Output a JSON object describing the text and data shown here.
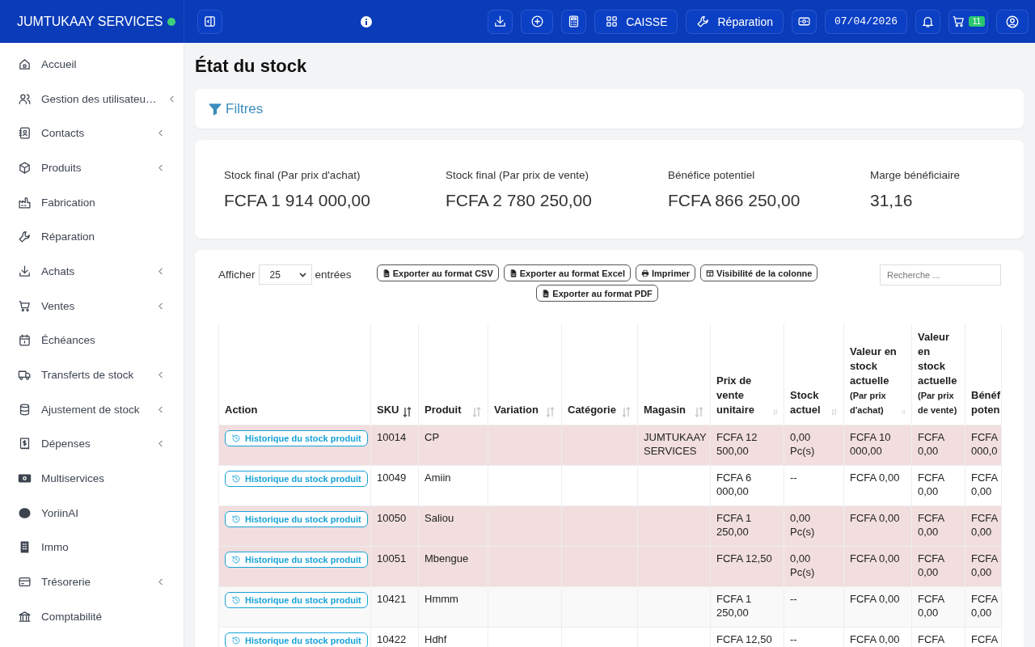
{
  "brand": {
    "name": "JUMTUKAAY SERVICES",
    "online": true
  },
  "topbar": {
    "caisse": "CAISSE",
    "repair": "Réparation",
    "date": "07/04/2026",
    "cart_count": "11"
  },
  "sidebar": {
    "items": [
      {
        "label": "Accueil",
        "submenu": false
      },
      {
        "label": "Gestion des utilisateu…",
        "submenu": true
      },
      {
        "label": "Contacts",
        "submenu": true
      },
      {
        "label": "Produits",
        "submenu": true
      },
      {
        "label": "Fabrication",
        "submenu": false
      },
      {
        "label": "Réparation",
        "submenu": false
      },
      {
        "label": "Achats",
        "submenu": true
      },
      {
        "label": "Ventes",
        "submenu": true
      },
      {
        "label": "Échéances",
        "submenu": false
      },
      {
        "label": "Transferts de stock",
        "submenu": true
      },
      {
        "label": "Ajustement de stock",
        "submenu": true
      },
      {
        "label": "Dépenses",
        "submenu": true
      },
      {
        "label": "Multiservices",
        "submenu": false
      },
      {
        "label": "YoriinAI",
        "submenu": false
      },
      {
        "label": "Immo",
        "submenu": false
      },
      {
        "label": "Trésorerie",
        "submenu": true
      },
      {
        "label": "Comptabilité",
        "submenu": false
      }
    ]
  },
  "page_title": "État du stock",
  "filters": {
    "label": "Filtres"
  },
  "summary": [
    {
      "label": "Stock final (Par prix d'achat)",
      "value": "FCFA 1 914 000,00"
    },
    {
      "label": "Stock final (Par prix de vente)",
      "value": "FCFA 2 780 250,00"
    },
    {
      "label": "Bénéfice potentiel",
      "value": "FCFA 866 250,00"
    },
    {
      "label": "Marge bénéficiaire",
      "value": "31,16"
    }
  ],
  "table_controls": {
    "show_label": "Afficher",
    "page_size": "25",
    "entries_label": "entrées",
    "search_placeholder": "Recherche ...",
    "buttons": [
      {
        "label": "Exporter au format CSV"
      },
      {
        "label": "Exporter au format Excel"
      },
      {
        "label": "Imprimer"
      },
      {
        "label": "Visibilité de la colonne"
      },
      {
        "label": "Exporter au format PDF"
      }
    ]
  },
  "table": {
    "columns": [
      {
        "label": "Action",
        "sortable": false
      },
      {
        "label": "SKU",
        "sortable": true,
        "sorted": true
      },
      {
        "label": "Produit",
        "sortable": true,
        "sorted": false
      },
      {
        "label": "Variation",
        "sortable": true,
        "sorted": false
      },
      {
        "label": "Catégorie",
        "sortable": true,
        "sorted": false
      },
      {
        "label": "Magasin",
        "sortable": true,
        "sorted": false
      },
      {
        "label": "Prix de vente unitaire",
        "sortable": true,
        "sorted": false
      },
      {
        "label": "Stock actuel",
        "sortable": true,
        "sorted": false
      },
      {
        "label": "Valeur en stock actuelle",
        "note": "(Par prix d'achat)",
        "sortable": true,
        "sorted": false
      },
      {
        "label": "Valeur en stock actuelle",
        "note": "(Par prix de vente)"
      },
      {
        "label": "Bénéf poten"
      }
    ],
    "rows": [
      {
        "alert": true,
        "action": "Historique du stock produit",
        "sku": "10014",
        "product": "CP",
        "store": "JUMTUKAAY SERVICES",
        "price": "FCFA 12 500,00",
        "stock": "0,00 Pc(s)",
        "value_buy": "FCFA 10 000,00",
        "value_sell": "FCFA 0,00",
        "profit": "FCFA 000,0"
      },
      {
        "alert": false,
        "action": "Historique du stock produit",
        "sku": "10049",
        "product": "Amiin",
        "price": "FCFA 6 000,00",
        "stock": "--",
        "value_buy": "FCFA 0,00",
        "value_sell": "FCFA 0,00",
        "profit": "FCFA 0,00"
      },
      {
        "alert": true,
        "action": "Historique du stock produit",
        "sku": "10050",
        "product": "Saliou",
        "price": "FCFA 1 250,00",
        "stock": "0,00 Pc(s)",
        "value_buy": "FCFA 0,00",
        "value_sell": "FCFA 0,00",
        "profit": "FCFA 0,00"
      },
      {
        "alert": true,
        "action": "Historique du stock produit",
        "sku": "10051",
        "product": "Mbengue",
        "price": "FCFA 12,50",
        "stock": "0,00 Pc(s)",
        "value_buy": "FCFA 0,00",
        "value_sell": "FCFA 0,00",
        "profit": "FCFA 0,00"
      },
      {
        "alert": false,
        "action": "Historique du stock produit",
        "sku": "10421",
        "product": "Hmmm",
        "price": "FCFA 1 250,00",
        "stock": "--",
        "value_buy": "FCFA 0,00",
        "value_sell": "FCFA 0,00",
        "profit": "FCFA 0,00"
      },
      {
        "alert": false,
        "action": "Historique du stock produit",
        "sku": "10422",
        "product": "Hdhf",
        "price": "FCFA 12,50",
        "stock": "--",
        "value_buy": "FCFA 0,00",
        "value_sell": "FCFA",
        "profit": "FCFA"
      }
    ]
  }
}
